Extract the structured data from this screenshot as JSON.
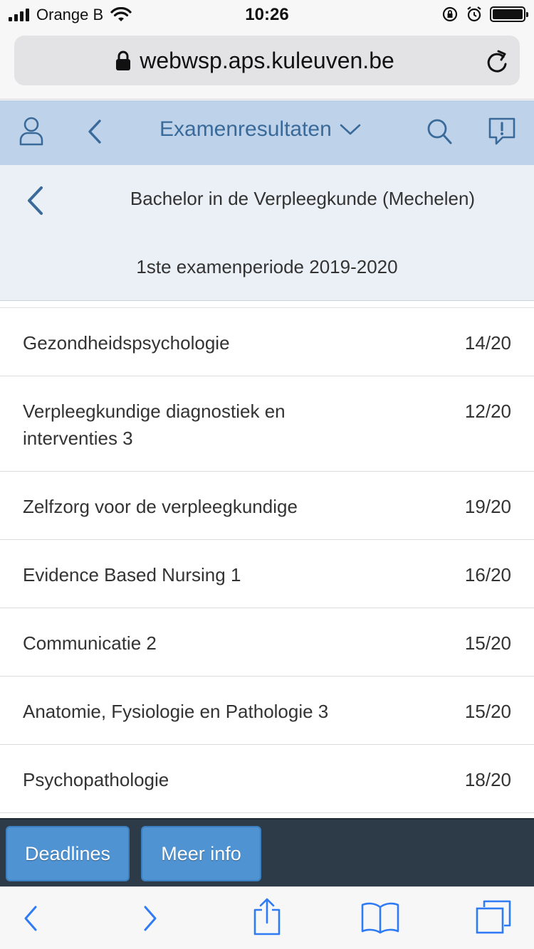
{
  "status_bar": {
    "carrier": "Orange B",
    "time": "10:26"
  },
  "browser": {
    "url": "webwsp.aps.kuleuven.be"
  },
  "app_header": {
    "title": "Examenresultaten"
  },
  "sub_header": {
    "program": "Bachelor in de Verpleegkunde (Mechelen)",
    "period": "1ste examenperiode 2019-2020"
  },
  "results": [
    {
      "course": "Gezondheidspsychologie",
      "score": "14/20"
    },
    {
      "course": "Verpleegkundige diagnostiek en interventies 3",
      "score": "12/20"
    },
    {
      "course": "Zelfzorg voor de verpleegkundige",
      "score": "19/20"
    },
    {
      "course": "Evidence Based Nursing 1",
      "score": "16/20"
    },
    {
      "course": "Communicatie 2",
      "score": "15/20"
    },
    {
      "course": "Anatomie, Fysiologie en Pathologie 3",
      "score": "15/20"
    },
    {
      "course": "Psychopathologie",
      "score": "18/20"
    }
  ],
  "actions": {
    "deadlines": "Deadlines",
    "meer_info": "Meer info"
  },
  "icons": {
    "profile": "user-icon",
    "back": "chevron-left-icon",
    "dropdown": "chevron-down-icon",
    "search": "search-icon",
    "feedback": "feedback-icon",
    "lock": "lock-icon",
    "reload": "reload-icon",
    "share": "share-icon",
    "bookmarks": "bookmarks-icon",
    "tabs": "tabs-icon"
  },
  "colors": {
    "header_bg": "#bed3e9",
    "accent": "#3a6a9a",
    "button_bg": "#4f93d3",
    "action_bar_bg": "#2d3a48",
    "safari_blue": "#2f7bf5"
  }
}
